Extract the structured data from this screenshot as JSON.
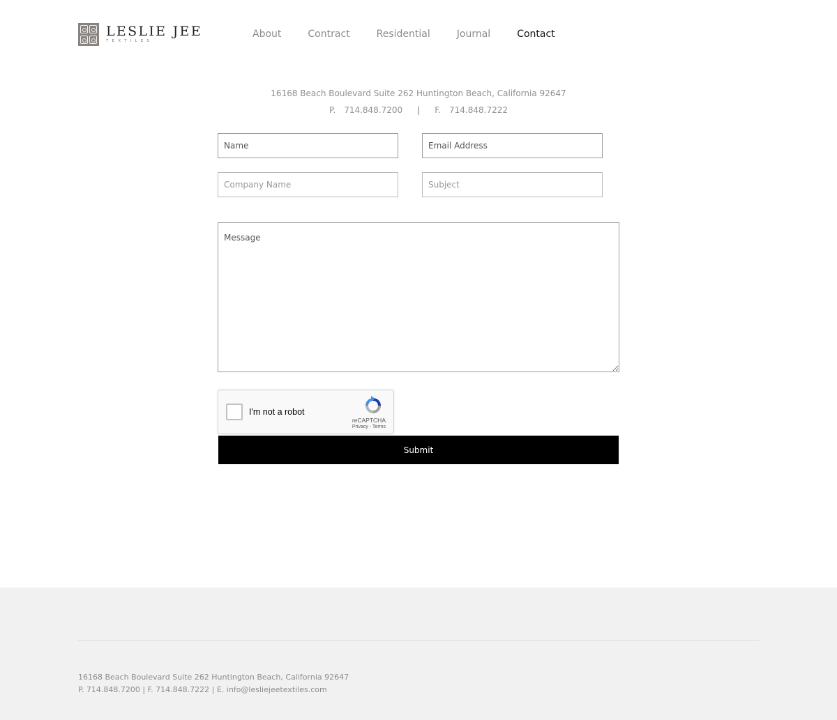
{
  "brand": {
    "name": "LESLIE JEE",
    "tagline": "TEXTILES"
  },
  "nav": {
    "items": [
      {
        "label": "About"
      },
      {
        "label": "Contract"
      },
      {
        "label": "Residential"
      },
      {
        "label": "Journal"
      },
      {
        "label": "Contact"
      }
    ],
    "active": "Contact"
  },
  "contact_info": {
    "address": "16168 Beach Boulevard Suite 262 Huntington Beach, California 92647",
    "phone_label": "P.",
    "phone": "714.848.7200",
    "separator": "|",
    "fax_label": "F.",
    "fax": "714.848.7222"
  },
  "form": {
    "name_placeholder": "Name",
    "email_placeholder": "Email Address",
    "company_placeholder": "Company Name",
    "subject_placeholder": "Subject",
    "message_placeholder": "Message",
    "submit_label": "Submit"
  },
  "recaptcha": {
    "label": "I'm not a robot",
    "brand": "reCAPTCHA",
    "links": "Privacy - Terms",
    "checked": false
  },
  "footer": {
    "address": "16168 Beach Boulevard Suite 262 Huntington Beach, California 92647",
    "contact_line": "P. 714.848.7200 | F. 714.848.7222 | E. info@lesliejeetextiles.com"
  },
  "colors": {
    "accent": "#000000",
    "nav_inactive": "#8c8c8c",
    "footer_bg": "#f1f1f1"
  }
}
